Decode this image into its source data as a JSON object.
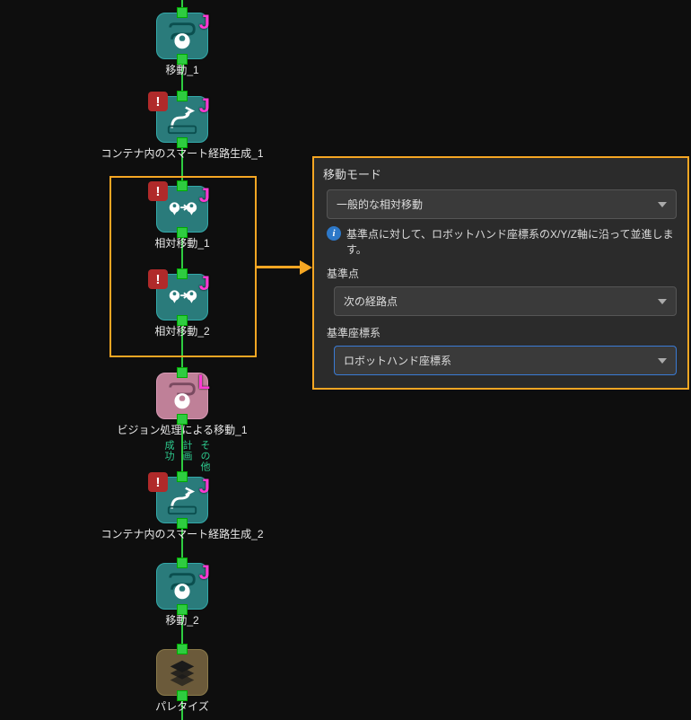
{
  "nodes": {
    "move1": {
      "label": "移動_1",
      "badge": "J"
    },
    "smart1": {
      "label": "コンテナ内のスマート経路生成_1",
      "badge": "J",
      "error": "!"
    },
    "rel1": {
      "label": "相対移動_1",
      "badge": "J",
      "error": "!"
    },
    "rel2": {
      "label": "相対移動_2",
      "badge": "J",
      "error": "!"
    },
    "vision1": {
      "label": "ビジョン処理による移動_1",
      "badge": "L"
    },
    "smart2": {
      "label": "コンテナ内のスマート経路生成_2",
      "badge": "J",
      "error": "!"
    },
    "move2": {
      "label": "移動_2",
      "badge": "J"
    },
    "palletize": {
      "label": "パレタイズ"
    }
  },
  "branches": {
    "success": "成功",
    "plan": "計画",
    "other": "その他"
  },
  "panel": {
    "title": "移動モード",
    "mode_dropdown": "一般的な相対移動",
    "info_text": "基準点に対して、ロボットハンド座標系のX/Y/Z軸に沿って並進します。",
    "ref_point_label": "基準点",
    "ref_point_value": "次の経路点",
    "ref_frame_label": "基準座標系",
    "ref_frame_value": "ロボットハンド座標系"
  },
  "icons": {
    "info": "i",
    "error": "!"
  }
}
